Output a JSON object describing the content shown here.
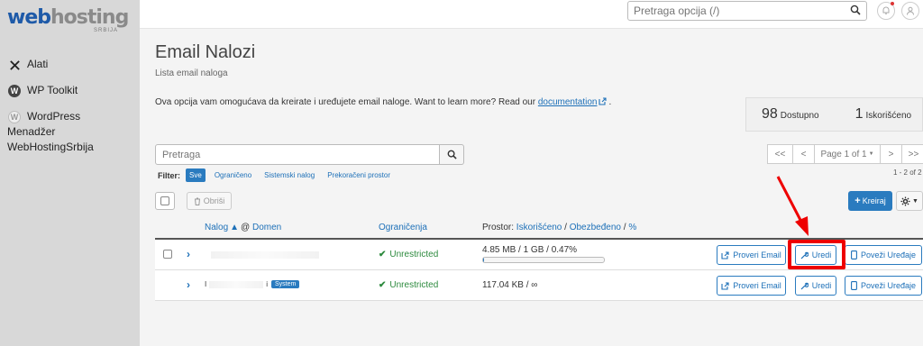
{
  "sidebar": {
    "logo_web": "web",
    "logo_hosting": "hosting",
    "logo_sub": "SRBIJA",
    "items": [
      {
        "label": "Alati"
      },
      {
        "label": "WP Toolkit"
      },
      {
        "label_line1": "WordPress",
        "label_line2": "Menadžer",
        "label_line3": "WebHostingSrbija"
      }
    ]
  },
  "topbar": {
    "search_placeholder": "Pretraga opcija (/)"
  },
  "page": {
    "title": "Email Nalozi",
    "subtitle": "Lista email naloga",
    "description": "Ova opcija vam omogućava da kreirate i uređujete email naloge. Want to learn more? Read our ",
    "doc_link": "documentation",
    "desc_end": "."
  },
  "stats": [
    {
      "value": "98",
      "label": "Dostupno"
    },
    {
      "value": "1",
      "label": "Iskorišćeno"
    }
  ],
  "search": {
    "placeholder": "Pretraga"
  },
  "pager": {
    "first": "<<",
    "prev": "<",
    "page": "Page 1 of 1",
    "next": ">",
    "last": ">>",
    "range": "1 - 2 of 2"
  },
  "filter": {
    "label": "Filter:",
    "options": [
      "Sve",
      "Ograničeno",
      "Sistemski nalog",
      "Prekoračeni prostor"
    ]
  },
  "toolbar": {
    "delete_label": "Obriši",
    "create_label": "Kreiraj"
  },
  "table": {
    "col_account": "Nalog",
    "col_at": "@",
    "col_domain": "Domen",
    "col_limits": "Ograničenja",
    "col_storage_prefix": "Prostor:",
    "col_storage_used": "Iskorišćeno",
    "col_storage_sep1": "/",
    "col_storage_quota": "Obezbeđeno",
    "col_storage_sep2": "/",
    "col_storage_pct": "%",
    "rows": [
      {
        "restriction": "Unrestricted",
        "storage": "4.85 MB / 1 GB / 0.47%",
        "usage_fraction": 0.0047,
        "badge": ""
      },
      {
        "restriction": "Unrestricted",
        "storage": "117.04 KB / ∞",
        "badge": "System",
        "account_fragment_a": "I",
        "account_fragment_b": "i"
      }
    ],
    "actions": {
      "check_email": "Proveri Email",
      "edit": "Uredi",
      "connect": "Poveži Uređaje"
    }
  },
  "colors": {
    "accent": "#2a7bbf",
    "success": "#2d8a3e",
    "highlight": "#e00000"
  }
}
